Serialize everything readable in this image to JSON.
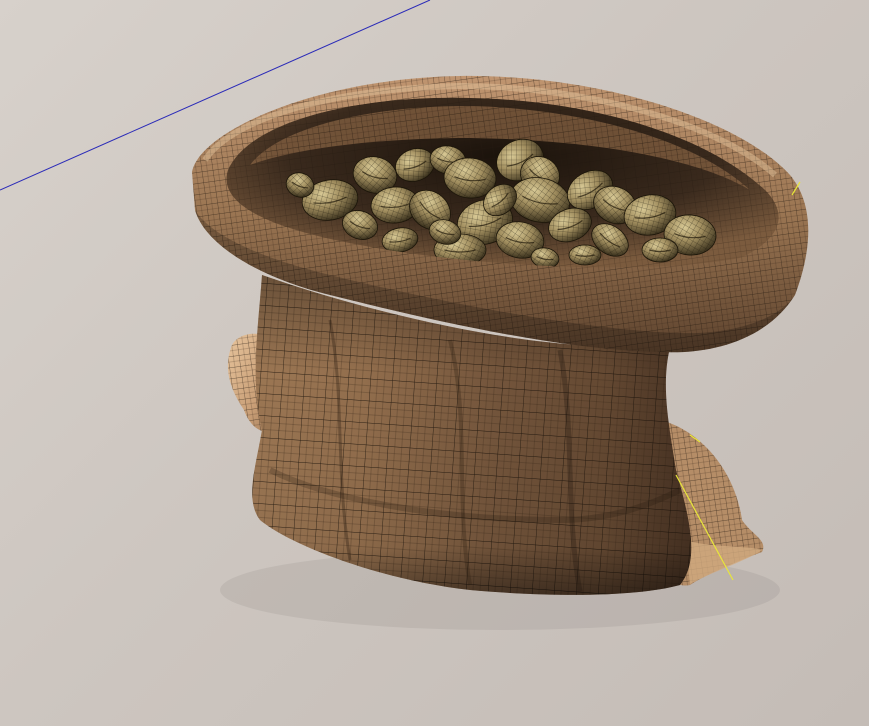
{
  "scene": {
    "subject": "burlap-sack-with-beans",
    "colors": {
      "background": "#cdc6c0",
      "burlap_light": "#c79e75",
      "burlap_mid": "#8d6a4b",
      "burlap_dark": "#3a2a1d",
      "bean_light": "#c9b98d",
      "bean_dark": "#3b321f",
      "guide_blue": "#2b2bb8",
      "guide_yellow": "#e8e63a"
    }
  }
}
